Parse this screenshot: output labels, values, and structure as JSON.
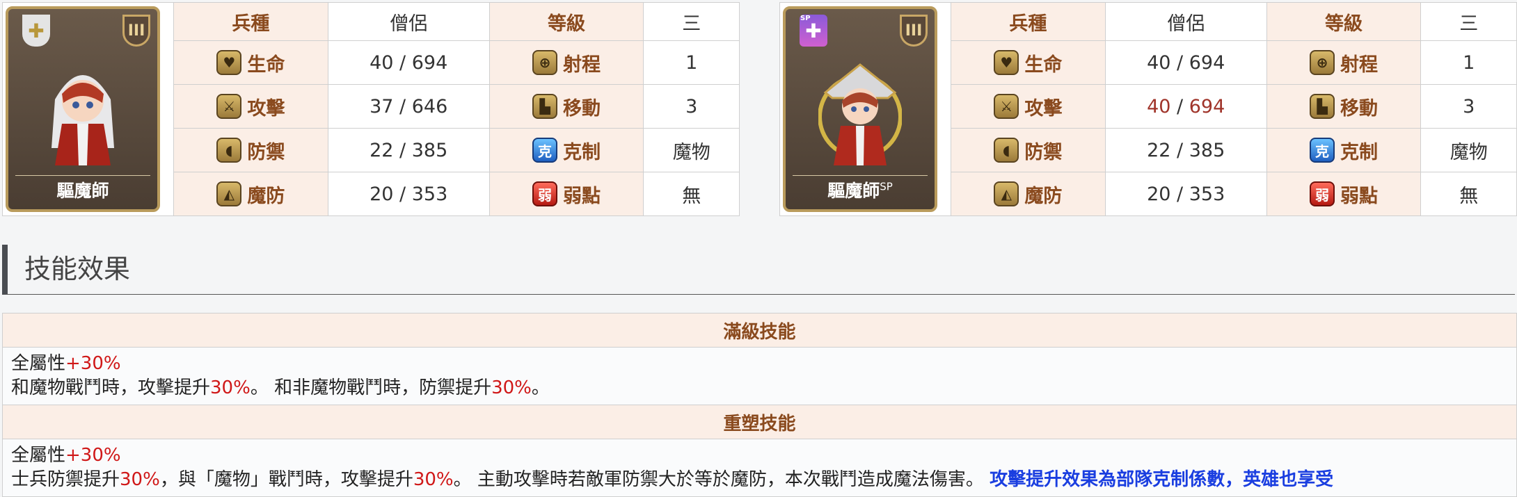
{
  "units": [
    {
      "name": "驅魔師",
      "name_sup": "",
      "rank": "III",
      "is_sp": false,
      "rows": [
        {
          "label1": "兵種",
          "value1": "僧侶",
          "label2": "等級",
          "value2": "三"
        },
        {
          "label1": "生命",
          "icon1": "heart-icon",
          "value1": "40 / 694",
          "label2": "射程",
          "icon2": "crosshair-icon",
          "value2": "1"
        },
        {
          "label1": "攻擊",
          "icon1": "sword-icon",
          "value1": "37 / 646",
          "label2": "移動",
          "icon2": "boot-icon",
          "value2": "3"
        },
        {
          "label1": "防禦",
          "icon1": "shield-icon",
          "value1": "22 / 385",
          "label2": "克制",
          "icon2": "counter-icon",
          "icon2_text": "克",
          "value2": "魔物"
        },
        {
          "label1": "魔防",
          "icon1": "magic-shield-icon",
          "value1": "20 / 353",
          "label2": "弱點",
          "icon2": "weakness-icon",
          "icon2_text": "弱",
          "value2": "無"
        }
      ]
    },
    {
      "name": "驅魔師",
      "name_sup": "SP",
      "rank": "III",
      "is_sp": true,
      "sp_label": "SP",
      "rows": [
        {
          "label1": "兵種",
          "value1": "僧侶",
          "label2": "等級",
          "value2": "三"
        },
        {
          "label1": "生命",
          "icon1": "heart-icon",
          "value1": "40 / 694",
          "label2": "射程",
          "icon2": "crosshair-icon",
          "value2": "1"
        },
        {
          "label1": "攻擊",
          "icon1": "sword-icon",
          "value1_a": "40",
          "value1_sep": " / ",
          "value1_b": "694",
          "value1_color": "#a0342a",
          "label2": "移動",
          "icon2": "boot-icon",
          "value2": "3"
        },
        {
          "label1": "防禦",
          "icon1": "shield-icon",
          "value1": "22 / 385",
          "label2": "克制",
          "icon2": "counter-icon",
          "icon2_text": "克",
          "value2": "魔物"
        },
        {
          "label1": "魔防",
          "icon1": "magic-shield-icon",
          "value1": "20 / 353",
          "label2": "弱點",
          "icon2": "weakness-icon",
          "icon2_text": "弱",
          "value2": "無"
        }
      ]
    }
  ],
  "section_title": "技能效果",
  "skills": {
    "max_skill": {
      "header": "滿級技能",
      "line1_a": "全屬性",
      "line1_b": "+30%",
      "line2_a": "和魔物戰鬥時，攻擊提升",
      "line2_b": "30%",
      "line2_c": "。 和非魔物戰鬥時，防禦提升",
      "line2_d": "30%",
      "line2_e": "。"
    },
    "remodel_skill": {
      "header": "重塑技能",
      "line1_a": "全屬性",
      "line1_b": "+30%",
      "line2_a": "士兵防禦提升",
      "line2_b": "30%",
      "line2_c": "，與「魔物」戰鬥時，攻擊提升",
      "line2_d": "30%",
      "line2_e": "。 主動攻擊時若敵軍防禦大於等於魔防，本次戰鬥造成魔法傷害。 ",
      "line2_f": "攻擊提升效果為部隊克制係數，英雄也享受"
    }
  }
}
